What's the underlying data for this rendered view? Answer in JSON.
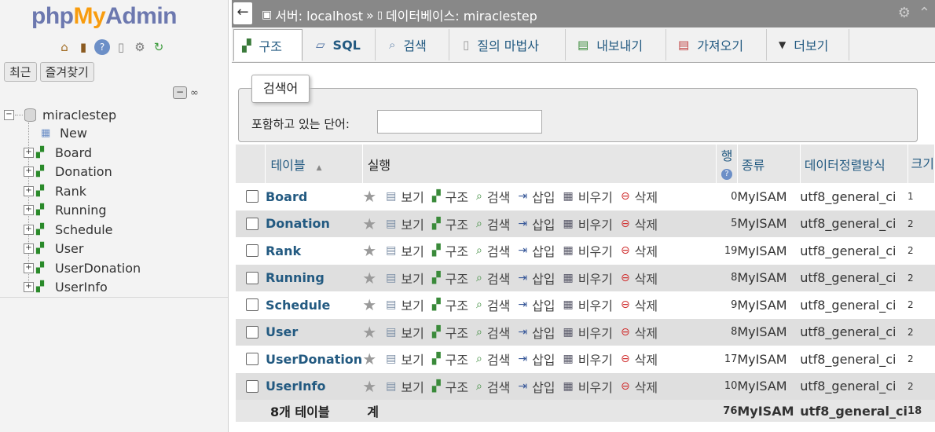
{
  "logo": {
    "php": "php",
    "my": "My",
    "admin": "Admin"
  },
  "nav": {
    "quick_icons": [
      "home-icon",
      "exit-icon",
      "help-icon",
      "docs-icon",
      "settings-icon",
      "reload-icon"
    ],
    "tabs": [
      "최근",
      "즐겨찾기"
    ],
    "db": "miraclestep",
    "new_label": "New",
    "tables": [
      "Board",
      "Donation",
      "Rank",
      "Running",
      "Schedule",
      "User",
      "UserDonation",
      "UserInfo"
    ]
  },
  "topbar": {
    "server_label": "서버: localhost",
    "sep": "»",
    "db_label": "데이터베이스: miraclestep"
  },
  "menu": [
    {
      "label": "구조",
      "icon": "structure-icon"
    },
    {
      "label": "SQL",
      "icon": "sql-icon"
    },
    {
      "label": "검색",
      "icon": "search-icon"
    },
    {
      "label": "질의 마법사",
      "icon": "query-icon"
    },
    {
      "label": "내보내기",
      "icon": "export-icon"
    },
    {
      "label": "가져오기",
      "icon": "import-icon"
    },
    {
      "label": "더보기",
      "icon": "chevron-down-icon"
    }
  ],
  "search": {
    "legend": "검색어",
    "label": "포함하고 있는 단어:",
    "value": ""
  },
  "table": {
    "headers": {
      "name": "테이블",
      "sort": "▲",
      "action": "실행",
      "rows": "행",
      "type": "종류",
      "collation": "데이터정렬방식",
      "overhead": "크기"
    },
    "actions": [
      "보기",
      "구조",
      "검색",
      "삽입",
      "비우기",
      "삭제"
    ],
    "rows": [
      {
        "name": "Board",
        "rows": "0",
        "engine": "MyISAM",
        "collation": "utf8_general_ci",
        "size": "1"
      },
      {
        "name": "Donation",
        "rows": "5",
        "engine": "MyISAM",
        "collation": "utf8_general_ci",
        "size": "2"
      },
      {
        "name": "Rank",
        "rows": "19",
        "engine": "MyISAM",
        "collation": "utf8_general_ci",
        "size": "2"
      },
      {
        "name": "Running",
        "rows": "8",
        "engine": "MyISAM",
        "collation": "utf8_general_ci",
        "size": "2"
      },
      {
        "name": "Schedule",
        "rows": "9",
        "engine": "MyISAM",
        "collation": "utf8_general_ci",
        "size": "2"
      },
      {
        "name": "User",
        "rows": "8",
        "engine": "MyISAM",
        "collation": "utf8_general_ci",
        "size": "2"
      },
      {
        "name": "UserDonation",
        "rows": "17",
        "engine": "MyISAM",
        "collation": "utf8_general_ci",
        "size": "2"
      },
      {
        "name": "UserInfo",
        "rows": "10",
        "engine": "MyISAM",
        "collation": "utf8_general_ci",
        "size": "2"
      }
    ],
    "footer": {
      "count": "8개 테이블",
      "sum": "계",
      "rows": "76",
      "engine": "MyISAM",
      "collation": "utf8_general_ci",
      "size": "18"
    }
  }
}
